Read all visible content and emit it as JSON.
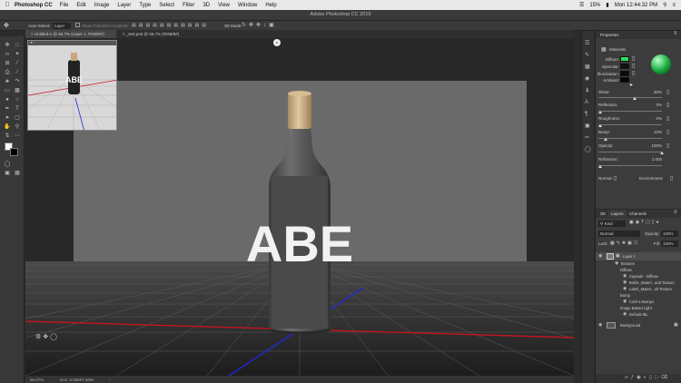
{
  "menubar": {
    "app": "Photoshop CC",
    "items": [
      "File",
      "Edit",
      "Image",
      "Layer",
      "Type",
      "Select",
      "Filter",
      "3D",
      "View",
      "Window",
      "Help"
    ],
    "battery": "15%",
    "clock": "Mon 12:44:32 PM"
  },
  "optionsbar": {
    "auto_select_label": "Auto-Select:",
    "auto_select_value": "Layer",
    "show_transform": "Show Transform Controls",
    "mode_label": "3D Mode:",
    "window_title": "Adobe Photoshop CC 2019"
  },
  "tabs": {
    "doc1": "Untitled-1 @ 66.7% (Layer 1, RGB/8#)",
    "doc2": "_test.psd @ 66.7% (RGB/8#)"
  },
  "canvas": {
    "label_text": "ABE"
  },
  "statusbar": {
    "zoom": "66.67%",
    "doc": "Doc: 5.93M/7.50M"
  },
  "properties": {
    "tab": "Properties",
    "section": "Materials",
    "diffuse": "Diffuse:",
    "specular": "Specular:",
    "illumination": "Illumination:",
    "ambient": "Ambient:",
    "shine": "Shine:",
    "shine_val": "50%",
    "reflection": "Reflection:",
    "reflection_val": "0%",
    "roughness": "Roughness:",
    "roughness_val": "0%",
    "bump": "Bump:",
    "bump_val": "10%",
    "opacity": "Opacity:",
    "opacity_val": "100%",
    "refraction": "Refraction:",
    "refraction_val": "1.000",
    "normal": "Normal:",
    "environment": "Environment:",
    "colors": {
      "diffuse": "#2ee05a",
      "specular": "#111111",
      "illumination": "#0a0a0a",
      "ambient": "#050505"
    }
  },
  "layers": {
    "tabs": [
      "3D",
      "Layers",
      "Channels"
    ],
    "kind": "Kind",
    "blend": "Normal",
    "opacity_label": "Opacity:",
    "opacity_val": "100%",
    "lock_label": "Lock:",
    "fill_label": "Fill:",
    "fill_val": "100%",
    "items": [
      {
        "label": "Layer 1"
      },
      {
        "label": "Textures"
      },
      {
        "label": "Diffuse"
      },
      {
        "label": "Capsule - Diffuse"
      },
      {
        "label": "Bottle_Materi...ault Texture"
      },
      {
        "label": "Label_Materi...ult Texture"
      },
      {
        "label": "Bump"
      },
      {
        "label": "Cork-4-Bump1"
      },
      {
        "label": "Image Based Light"
      },
      {
        "label": "Default IBL"
      },
      {
        "label": "Background"
      }
    ]
  }
}
